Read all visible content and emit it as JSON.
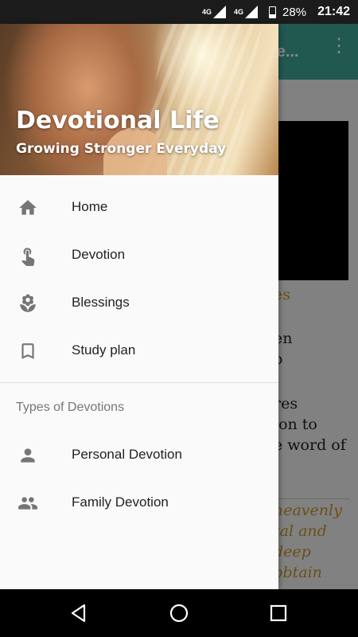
{
  "status_bar": {
    "network_1": "4G",
    "network_2": "4G",
    "battery_percent": "28%",
    "time": "21:42"
  },
  "background_app": {
    "title_fragment": "re...",
    "text_lines": [
      "es",
      "en",
      "o",
      "res",
      "ion to",
      "e word of"
    ],
    "italic_lines": [
      "heavenly",
      "tal and",
      "deep",
      "obtain"
    ]
  },
  "drawer": {
    "title": "Devotional Life",
    "subtitle": "Growing Stronger Everyday",
    "main_items": [
      {
        "label": "Home",
        "icon": "home-icon"
      },
      {
        "label": "Devotion",
        "icon": "touch-icon"
      },
      {
        "label": "Blessings",
        "icon": "flower-icon"
      },
      {
        "label": "Study plan",
        "icon": "bookmark-icon"
      }
    ],
    "section_title": "Types of Devotions",
    "section_items": [
      {
        "label": "Personal Devotion",
        "icon": "person-icon"
      },
      {
        "label": "Family Devotion",
        "icon": "people-icon"
      }
    ]
  },
  "colors": {
    "app_bar": "#3fa89a",
    "icon_grey": "#757575",
    "accent_gold": "#c9952a"
  }
}
